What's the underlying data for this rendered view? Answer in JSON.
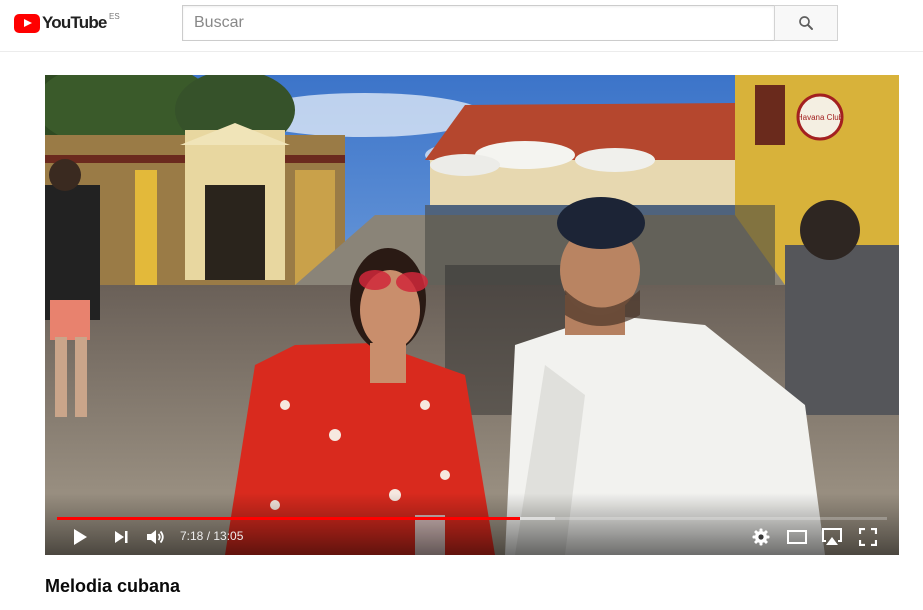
{
  "masthead": {
    "logo_text": "YouTube",
    "country_code": "ES",
    "brand_color": "#ff0000"
  },
  "search": {
    "placeholder": "Buscar",
    "button_icon": "search-icon"
  },
  "player": {
    "current_time": "7:18",
    "separator": " / ",
    "duration": "13:05",
    "played_fraction": 0.558,
    "loaded_fraction": 0.6,
    "progress_color": "#ff0000",
    "controls": [
      "play-icon",
      "next-icon",
      "volume-icon",
      "settings-icon",
      "theater-mode-icon",
      "airplay-icon",
      "fullscreen-icon"
    ]
  },
  "video": {
    "title": "Melodia cubana",
    "sign_text": "Havana Club"
  }
}
